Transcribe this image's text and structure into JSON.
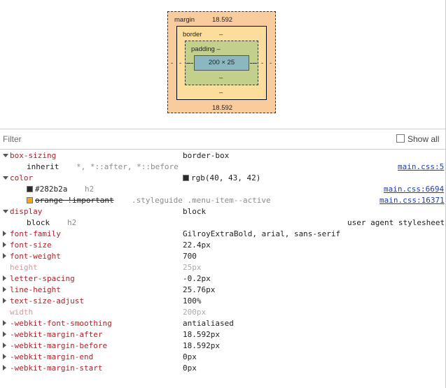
{
  "box_model": {
    "margin_label": "margin",
    "margin_top": "18.592",
    "margin_bottom": "18.592",
    "margin_left": "-",
    "margin_right": "-",
    "border_label": "border",
    "border_top": "–",
    "border_bottom": "–",
    "border_left": "-",
    "border_right": "-",
    "padding_label": "padding –",
    "padding_bottom": "–",
    "padding_left": "-",
    "padding_right": "-",
    "content_size": "200 × 25",
    "colors": {
      "margin": "#f9cc9d",
      "border": "#fddd9b",
      "padding": "#c3d08b",
      "content": "#8cb6c0"
    }
  },
  "filter": {
    "placeholder": "Filter",
    "show_all_label": "Show all",
    "show_all_checked": false
  },
  "properties": {
    "box_sizing": {
      "name": "box-sizing",
      "value": "border-box",
      "sub": {
        "value": "inherit",
        "selector": "*, *::after, *::before",
        "source": "main.css:5"
      }
    },
    "color": {
      "name": "color",
      "value": "rgb(40, 43, 42)",
      "swatch": "#282b2a",
      "sub1": {
        "value": "#282b2a",
        "selector": "h2",
        "source": "main.css:6694",
        "swatch": "#282b2a"
      },
      "sub2": {
        "value": "orange !important",
        "selector": ".styleguide .menu-item--active",
        "source": "main.css:16371",
        "swatch": "#ffa500"
      }
    },
    "display": {
      "name": "display",
      "value": "block",
      "sub": {
        "value": "block",
        "selector": "h2",
        "source": "user agent stylesheet"
      }
    },
    "font_family": {
      "name": "font-family",
      "value": "GilroyExtraBold, arial, sans-serif"
    },
    "font_size": {
      "name": "font-size",
      "value": "22.4px"
    },
    "font_weight": {
      "name": "font-weight",
      "value": "700"
    },
    "height": {
      "name": "height",
      "value": "25px"
    },
    "letter_spacing": {
      "name": "letter-spacing",
      "value": "-0.2px"
    },
    "line_height": {
      "name": "line-height",
      "value": "25.76px"
    },
    "text_size_adjust": {
      "name": "text-size-adjust",
      "value": "100%"
    },
    "width": {
      "name": "width",
      "value": "200px"
    },
    "font_smoothing": {
      "name": "-webkit-font-smoothing",
      "value": "antialiased"
    },
    "margin_after": {
      "name": "-webkit-margin-after",
      "value": "18.592px"
    },
    "margin_before": {
      "name": "-webkit-margin-before",
      "value": "18.592px"
    },
    "margin_end": {
      "name": "-webkit-margin-end",
      "value": "0px"
    },
    "margin_start": {
      "name": "-webkit-margin-start",
      "value": "0px"
    }
  }
}
